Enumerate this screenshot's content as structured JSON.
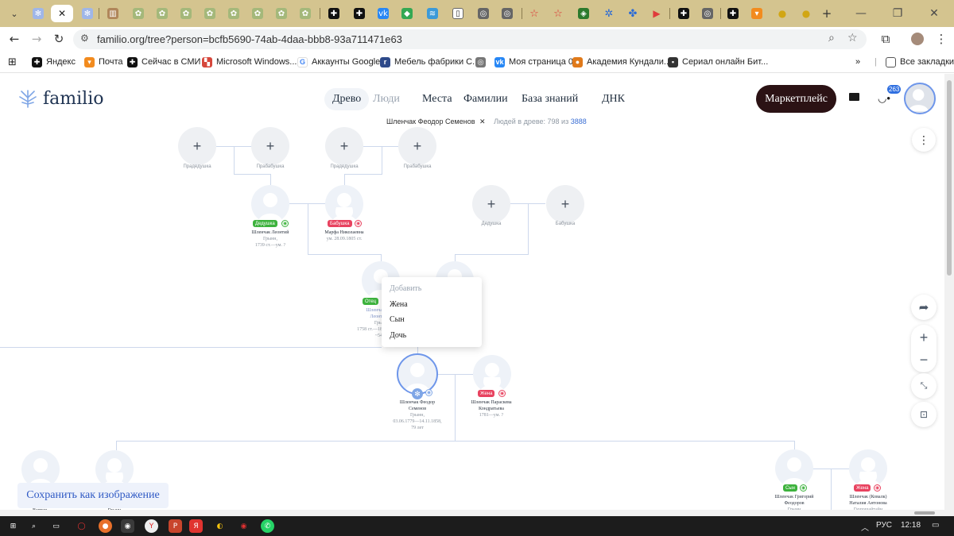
{
  "browser": {
    "url": "familio.org/tree?person=bcfb5690-74ab-4daa-bbb8-93a711471e63",
    "tab_icons": [
      "chevron-down-icon",
      "familio-tab-icon",
      "close-icon",
      "familio-tab-icon",
      "library-tab-icon",
      "familio-tab-icon",
      "familio-tab-icon",
      "familio-tab-icon",
      "familio-tab-icon",
      "familio-tab-icon",
      "familio-tab-icon",
      "familio-tab-icon",
      "familio-tab-icon",
      "sparkle-tab-icon",
      "sparkle-tab-icon",
      "vk-tab-icon",
      "maps-tab-icon",
      "wave-tab-icon",
      "doc-tab-icon",
      "globe-tab-icon",
      "globe-tab-icon",
      "star-tab-icon",
      "star-tab-icon",
      "game-tab-icon",
      "gear-tab-icon",
      "puzzle-tab-icon",
      "play-tab-icon",
      "sparkle-tab-icon",
      "globe-tab-icon",
      "sparkle-tab-icon",
      "mail-tab-icon",
      "chick-tab-icon",
      "chick-tab-icon",
      "new-tab-icon"
    ]
  },
  "bookmarks": [
    {
      "label": "",
      "icon": "apps-icon"
    },
    {
      "label": "Яндекс",
      "icon": "yandex-icon"
    },
    {
      "label": "Почта",
      "icon": "mail-icon"
    },
    {
      "label": "Сейчас в СМИ",
      "icon": "news-icon"
    },
    {
      "label": "Microsoft Windows...",
      "icon": "windows-icon"
    },
    {
      "label": "Аккаунты Google",
      "icon": "google-icon"
    },
    {
      "label": "Мебель фабрики С...",
      "icon": "furniture-icon"
    },
    {
      "label": "",
      "icon": "globe-icon"
    },
    {
      "label": "Моя страница 0",
      "icon": "vk-icon"
    },
    {
      "label": "Академия Кундали...",
      "icon": "academy-icon"
    },
    {
      "label": "Сериал онлайн Бит...",
      "icon": "film-icon"
    },
    {
      "label": "»",
      "icon": ""
    },
    {
      "label": "Все закладки",
      "icon": "folder-icon"
    }
  ],
  "header": {
    "logo_text": "familio",
    "nav": [
      "Древо",
      "Люди",
      "Места",
      "Фамилии",
      "База знаний",
      "ДНК"
    ],
    "market_button": "Маркетплейс",
    "notif_count": "263"
  },
  "tree_info": {
    "person": "Шленчак Феодор Семенов",
    "close": "✕",
    "count_label": "Людей в древе: 798 из",
    "total": "3888"
  },
  "tree": {
    "add_nodes": [
      {
        "label": "Прадедушка"
      },
      {
        "label": "Прабабушка"
      },
      {
        "label": "Прадедушка"
      },
      {
        "label": "Прабабушка"
      },
      {
        "label": "Дедушка"
      },
      {
        "label": "Бабушка"
      }
    ],
    "grandfather": {
      "role": "Дедушка",
      "name": "Шленчак Леонтий",
      "place": "Грынн,",
      "dates": "1739 ст.—ум. ?"
    },
    "grandmother": {
      "role": "Бабушка",
      "name": "Марфа Николаевна",
      "dates": "ум. 28.09.1805 ст."
    },
    "father": {
      "role": "Отец",
      "name_partial": "Шленча",
      "name2_partial": "Леонт",
      "place_partial": "Гры",
      "dates_partial": "1758 ст.—18",
      "age_partial": "~54"
    },
    "self": {
      "name": "Шленчак Феодор",
      "name2": "Семенов",
      "place": "Грынн,",
      "dates": "03.06.1779—14.11.1858,",
      "age": "79 лет"
    },
    "wife": {
      "role": "Жена",
      "name": "Шленчак Параскева",
      "name2": "Кондратьева",
      "dates": "1781—ум. ?"
    },
    "son": {
      "role": "Сын",
      "name": "Шленчак Григорий",
      "name2": "Феодоров",
      "place": "Грынн"
    },
    "daughter_in_law": {
      "role": "Жена",
      "name": "Шленчак (Ковалк)",
      "name2": "Наталия Антонова",
      "place": "Гюпошайтайн"
    },
    "bottom_left": {
      "label1": "Вертеп",
      "label2": "Грынн"
    }
  },
  "context_menu": {
    "header": "Добавить",
    "items": [
      "Жена",
      "Сын",
      "Дочь"
    ]
  },
  "save_button": "Сохранить как изображение",
  "taskbar": {
    "lang": "РУС",
    "time": "12:18"
  },
  "colors": {
    "tab_strip": "#d4c48f",
    "market_button": "#2b1214",
    "role_male": "#3db23d",
    "role_female": "#e8425f",
    "accent": "#2f59c4"
  }
}
